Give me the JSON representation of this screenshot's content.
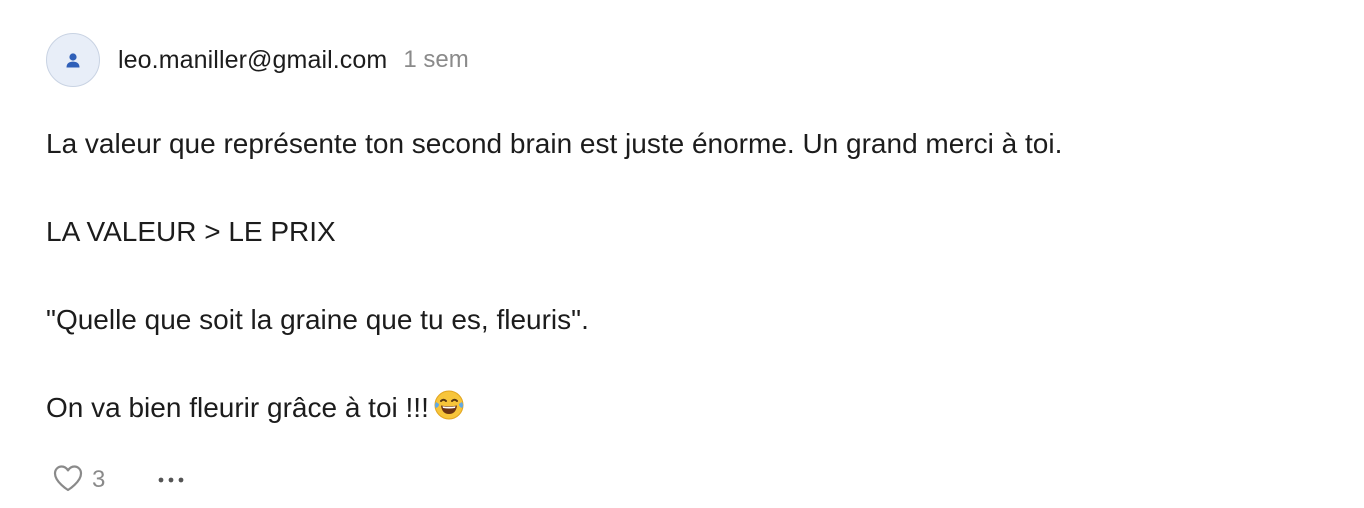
{
  "comment": {
    "author": "leo.maniller@gmail.com",
    "timestamp": "1 sem",
    "paragraphs": [
      "La valeur que représente ton second brain est juste énorme. Un grand merci à toi.",
      "LA VALEUR > LE PRIX",
      "\"Quelle que soit la graine que tu es, fleuris\".",
      "On va bien fleurir grâce à toi !!!"
    ],
    "emoji": "face-with-tears-of-joy",
    "like_count": "3"
  },
  "icons": {
    "avatar": "person-icon",
    "like": "heart-outline-icon",
    "more": "more-horizontal-icon"
  },
  "colors": {
    "avatar_bg": "#e8eef8",
    "avatar_icon": "#2f5fb8",
    "muted_text": "#8a8a8a",
    "main_text": "#1c1c1c"
  }
}
